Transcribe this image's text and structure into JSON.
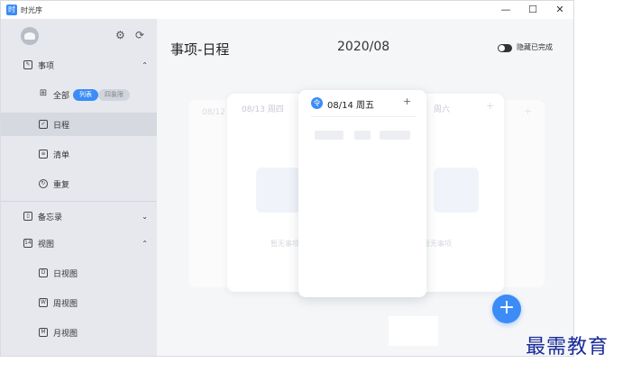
{
  "window": {
    "title": "时光序",
    "app_icon": "时",
    "controls": [
      "—",
      "☐",
      "✕"
    ]
  },
  "sidebar": {
    "sections": {
      "tasks": "事项",
      "all": "全部",
      "view_list": "列表",
      "view_quadrant": "四象限",
      "schedule": "日程",
      "checklist": "清单",
      "repeat": "重复",
      "memo": "备忘录",
      "views": "视图",
      "views_icon_num": "14",
      "day_view": "日视图",
      "week_view": "周视图",
      "month_view": "月视图"
    },
    "icons": {
      "settings": "⚙",
      "sync": "⟳"
    }
  },
  "main": {
    "title": "事项-日程",
    "month": "2020/08",
    "hide_completed": "隐藏已完成",
    "cards": {
      "far_left_date": "08/12",
      "left_date": "08/13 周四",
      "active_date": "08/14 周五",
      "right_date": "周六",
      "empty_left": "暂无事项",
      "empty_right": "暂无事项"
    },
    "plus": "+"
  },
  "watermark": "最需教育",
  "colors": {
    "accent": "#3b8cf7",
    "sidebar_bg": "#e6e8ee",
    "main_bg": "#f5f6f8",
    "watermark": "#1a2a99"
  }
}
